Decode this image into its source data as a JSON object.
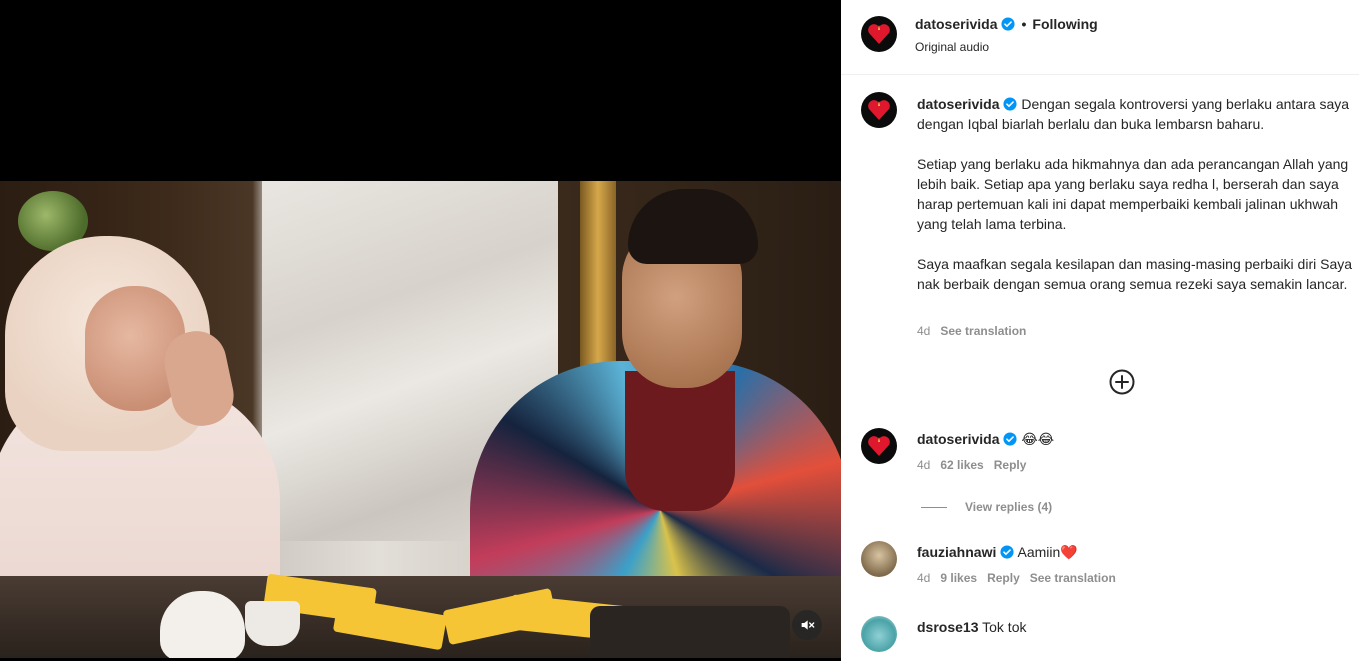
{
  "video": {
    "mute_icon": "speaker-muted-icon"
  },
  "header": {
    "username": "datoserivida",
    "separator": "•",
    "follow_status": "Following",
    "audio": "Original audio"
  },
  "caption": {
    "username": "datoserivida",
    "text": "Dengan segala kontroversi yang berlaku antara saya dengan Iqbal biarlah berlalu dan buka lembarsn baharu.\n\nSetiap yang berlaku ada hikmahnya dan ada perancangan Allah yang lebih baik. Setiap apa yang berlaku saya redha l, berserah dan saya harap pertemuan kali ini dapat memperbaiki kembali jalinan ukhwah yang telah lama terbina.\n\nSaya maafkan segala kesilapan dan masing-masing perbaiki diri Saya nak berbaik dengan semua orang semua rezeki saya semakin lancar.",
    "time": "4d",
    "see_translation": "See translation"
  },
  "load_more_icon": "plus-circle-icon",
  "comments": [
    {
      "username": "datoserivida",
      "text": "😂😂",
      "time": "4d",
      "likes": "62 likes",
      "reply": "Reply",
      "view_replies": "View replies (4)"
    },
    {
      "username": "fauziahnawi",
      "text": "Aamiin❤️",
      "time": "4d",
      "likes": "9 likes",
      "reply": "Reply",
      "see_translation": "See translation"
    },
    {
      "username": "dsrose13",
      "text": "Tok tok"
    }
  ],
  "colors": {
    "verified": "#0095f6",
    "meta_text": "#8e8e8e",
    "primary_text": "#262626",
    "heart_logo": "#e0182d"
  }
}
